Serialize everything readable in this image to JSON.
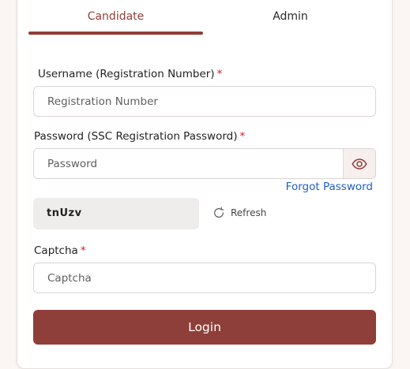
{
  "tabs": {
    "candidate": "Candidate",
    "admin": "Admin"
  },
  "username": {
    "label": "Username (Registration Number)",
    "required_mark": "*",
    "placeholder": "Registration Number",
    "value": ""
  },
  "password": {
    "label": "Password (SSC Registration Password)",
    "required_mark": "*",
    "placeholder": "Password",
    "value": "",
    "toggle_icon": "eye-icon",
    "forgot_link": "Forgot Password"
  },
  "captcha": {
    "code": "tnUzv",
    "refresh_label": "Refresh",
    "refresh_icon": "refresh-icon",
    "label": "Captcha",
    "required_mark": "*",
    "placeholder": "Captcha",
    "value": ""
  },
  "login_button": "Login",
  "colors": {
    "brand": "#8f3f39",
    "required": "#d3172b",
    "link": "#1f5fc2",
    "page_background": "#fbf5f3"
  }
}
